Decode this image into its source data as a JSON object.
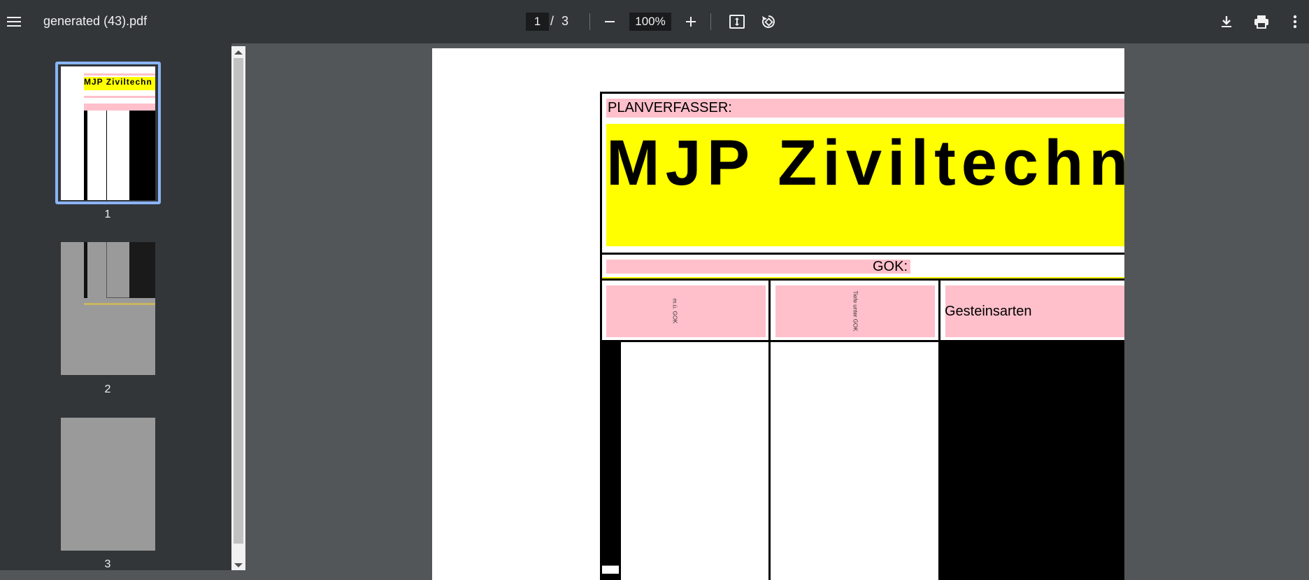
{
  "toolbar": {
    "title": "generated (43).pdf",
    "current_page": "1",
    "page_separator": "/",
    "total_pages": "3",
    "zoom": "100%"
  },
  "sidebar": {
    "thumbnails": [
      {
        "label": "1",
        "selected": true
      },
      {
        "label": "2",
        "selected": false
      },
      {
        "label": "3",
        "selected": false
      }
    ],
    "thumb1_banner_text": "MJP Ziviltechn"
  },
  "page": {
    "planverfasser_label": "PLANVERFASSER:",
    "banner_text": "MJP Ziviltechn",
    "gok_label": "GOK:",
    "col1_vertical_text": "m.ü. GOK",
    "col2_vertical_text": "Tiefe unter GOK",
    "col3_header": "Gesteinsarten"
  },
  "colors": {
    "toolbar_bg": "#323639",
    "viewer_bg": "#525659",
    "pink": "#ffc0cb",
    "yellow": "#ffff00",
    "selected_thumb_border": "#8ab4f8"
  }
}
